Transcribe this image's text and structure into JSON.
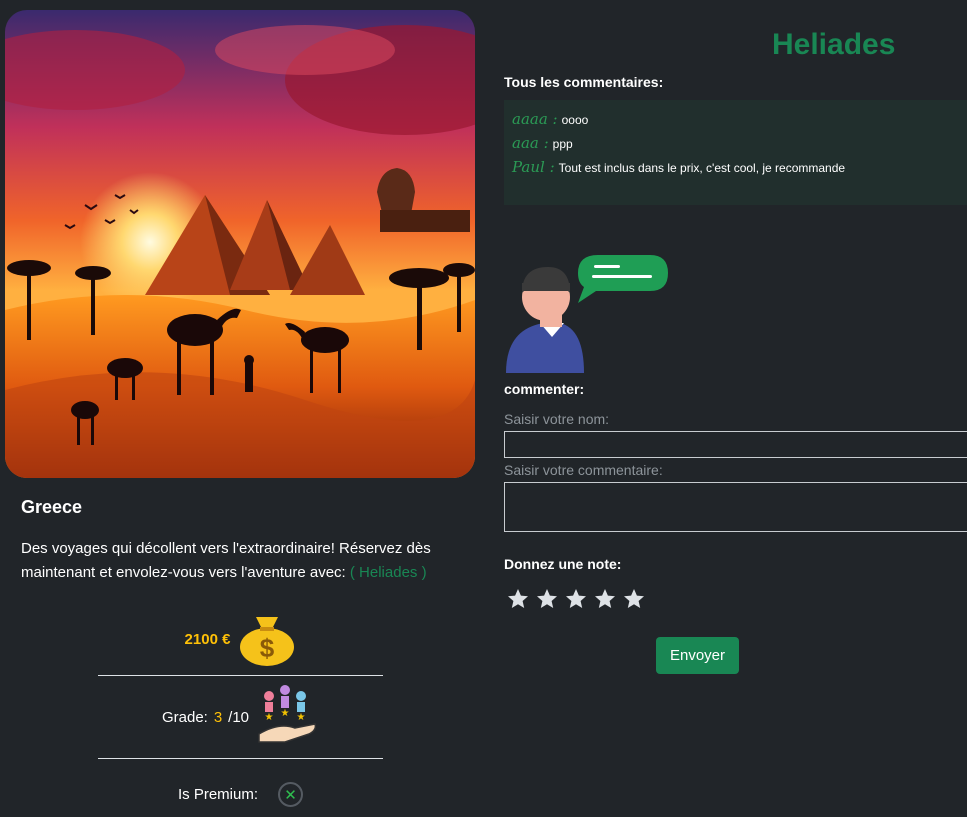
{
  "site": {
    "title": "Heliades"
  },
  "trip": {
    "title": "Greece",
    "description": "Des voyages qui décollent vers l'extraordinaire! Réservez dès maintenant et envolez-vous vers l'aventure avec:",
    "brand_link": "( Heliades )",
    "price": "2100 €",
    "price_icon": "money-bag-icon",
    "grade_label": "Grade:",
    "grade_value": "3",
    "grade_max": "/10",
    "grade_icon": "rating-hand-icon",
    "premium_label": "Is Premium:",
    "premium_icon": "x-circle-icon",
    "image_icon": "egypt-sunset-desert-image"
  },
  "comments": {
    "heading": "Tous les commentaires:",
    "items": [
      {
        "author": "aaaa :",
        "text": "oooo"
      },
      {
        "author": "aaa :",
        "text": "ppp"
      },
      {
        "author": "Paul :",
        "text": "Tout est inclus dans le prix, c'est cool, je recommande"
      }
    ]
  },
  "form": {
    "heading": "commenter:",
    "name_label": "Saisir votre nom:",
    "name_value": "",
    "comment_label": "Saisir votre commentaire:",
    "comment_value": "",
    "rating_heading": "Donnez une note:",
    "stars": 5,
    "submit_label": "Envoyer",
    "avatar_icon": "user-comment-avatar-icon"
  },
  "colors": {
    "background": "#212529",
    "accent": "#198754",
    "price": "#ffc107",
    "comments_bg": "#212f2d"
  }
}
